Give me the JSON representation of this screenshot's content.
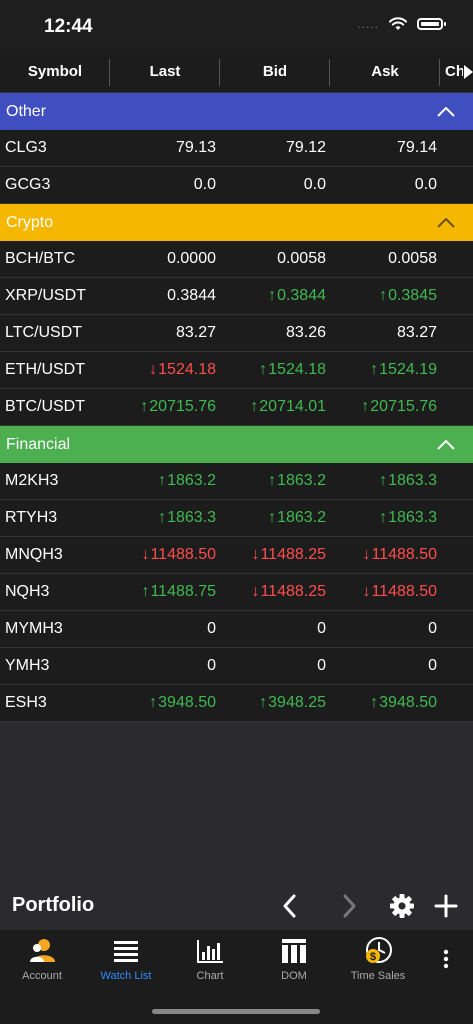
{
  "status": {
    "time": "12:44",
    "dots": "....."
  },
  "columns": [
    "Symbol",
    "Last",
    "Bid",
    "Ask",
    "Ch"
  ],
  "groups": [
    {
      "name": "Other",
      "color": "#3f4fbf",
      "rows": [
        {
          "symbol": "CLG3",
          "last": {
            "value": "79.13",
            "dir": "flat"
          },
          "bid": {
            "value": "79.12",
            "dir": "flat"
          },
          "ask": {
            "value": "79.14",
            "dir": "flat"
          }
        },
        {
          "symbol": "GCG3",
          "last": {
            "value": "0.0",
            "dir": "flat"
          },
          "bid": {
            "value": "0.0",
            "dir": "flat"
          },
          "ask": {
            "value": "0.0",
            "dir": "flat"
          }
        }
      ]
    },
    {
      "name": "Crypto",
      "color": "#f5b700",
      "rows": [
        {
          "symbol": "BCH/BTC",
          "last": {
            "value": "0.0000",
            "dir": "flat"
          },
          "bid": {
            "value": "0.0058",
            "dir": "flat"
          },
          "ask": {
            "value": "0.0058",
            "dir": "flat"
          }
        },
        {
          "symbol": "XRP/USDT",
          "last": {
            "value": "0.3844",
            "dir": "flat"
          },
          "bid": {
            "value": "0.3844",
            "dir": "up"
          },
          "ask": {
            "value": "0.3845",
            "dir": "up"
          }
        },
        {
          "symbol": "LTC/USDT",
          "last": {
            "value": "83.27",
            "dir": "flat"
          },
          "bid": {
            "value": "83.26",
            "dir": "flat"
          },
          "ask": {
            "value": "83.27",
            "dir": "flat"
          }
        },
        {
          "symbol": "ETH/USDT",
          "last": {
            "value": "1524.18",
            "dir": "down"
          },
          "bid": {
            "value": "1524.18",
            "dir": "up"
          },
          "ask": {
            "value": "1524.19",
            "dir": "up"
          }
        },
        {
          "symbol": "BTC/USDT",
          "last": {
            "value": "20715.76",
            "dir": "up"
          },
          "bid": {
            "value": "20714.01",
            "dir": "up"
          },
          "ask": {
            "value": "20715.76",
            "dir": "up"
          }
        }
      ]
    },
    {
      "name": "Financial",
      "color": "#4caf50",
      "rows": [
        {
          "symbol": "M2KH3",
          "last": {
            "value": "1863.2",
            "dir": "up"
          },
          "bid": {
            "value": "1863.2",
            "dir": "up"
          },
          "ask": {
            "value": "1863.3",
            "dir": "up"
          }
        },
        {
          "symbol": "RTYH3",
          "last": {
            "value": "1863.3",
            "dir": "up"
          },
          "bid": {
            "value": "1863.2",
            "dir": "up"
          },
          "ask": {
            "value": "1863.3",
            "dir": "up"
          }
        },
        {
          "symbol": "MNQH3",
          "last": {
            "value": "11488.50",
            "dir": "down"
          },
          "bid": {
            "value": "11488.25",
            "dir": "down"
          },
          "ask": {
            "value": "11488.50",
            "dir": "down"
          }
        },
        {
          "symbol": "NQH3",
          "last": {
            "value": "11488.75",
            "dir": "up"
          },
          "bid": {
            "value": "11488.25",
            "dir": "down"
          },
          "ask": {
            "value": "11488.50",
            "dir": "down"
          }
        },
        {
          "symbol": "MYMH3",
          "last": {
            "value": "0",
            "dir": "flat"
          },
          "bid": {
            "value": "0",
            "dir": "flat"
          },
          "ask": {
            "value": "0",
            "dir": "flat"
          }
        },
        {
          "symbol": "YMH3",
          "last": {
            "value": "0",
            "dir": "flat"
          },
          "bid": {
            "value": "0",
            "dir": "flat"
          },
          "ask": {
            "value": "0",
            "dir": "flat"
          }
        },
        {
          "symbol": "ESH3",
          "last": {
            "value": "3948.50",
            "dir": "up"
          },
          "bid": {
            "value": "3948.25",
            "dir": "up"
          },
          "ask": {
            "value": "3948.50",
            "dir": "up"
          }
        }
      ]
    }
  ],
  "arrows": {
    "up": "↑",
    "down": "↓",
    "flat": ""
  },
  "portfolio": {
    "title": "Portfolio"
  },
  "tabs": [
    {
      "label": "Account",
      "icon": "account-icon",
      "active": false
    },
    {
      "label": "Watch List",
      "icon": "watch-list-icon",
      "active": true
    },
    {
      "label": "Chart",
      "icon": "chart-icon",
      "active": false
    },
    {
      "label": "DOM",
      "icon": "dom-icon",
      "active": false
    },
    {
      "label": "Time Sales",
      "icon": "time-sales-icon",
      "active": false
    }
  ],
  "colors": {
    "up": "#3fb950",
    "down": "#ff4d4d",
    "accent": "#2d8cff",
    "account_icon": "#f5a623",
    "time_sales_icon": "#f5b700"
  }
}
